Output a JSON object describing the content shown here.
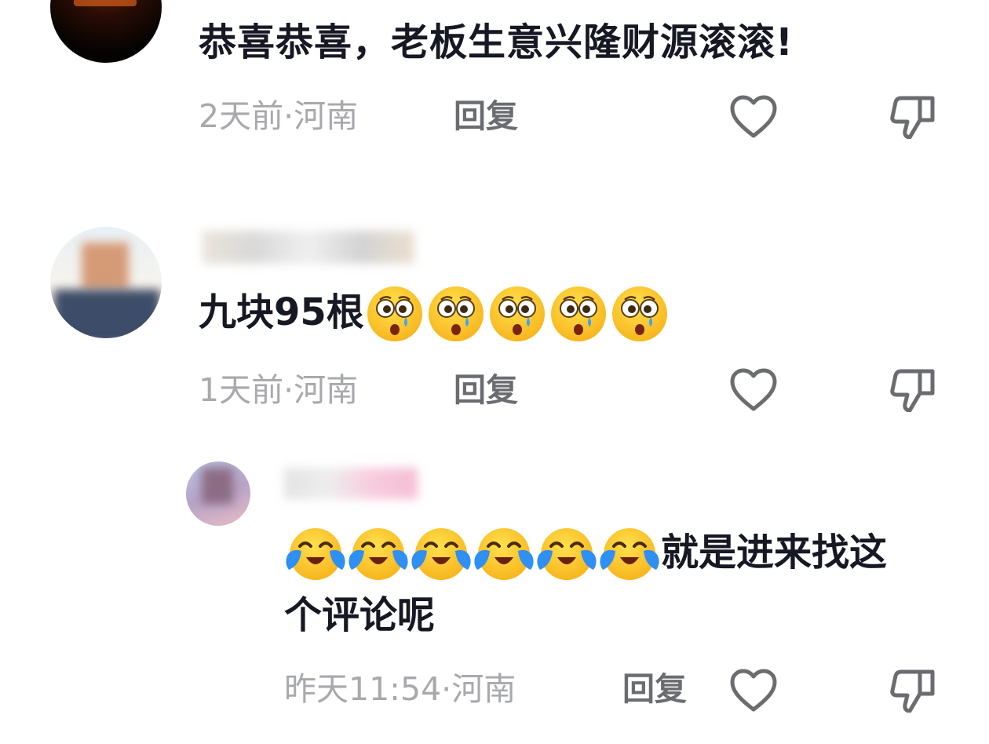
{
  "comments": [
    {
      "text": "恭喜恭喜，老板生意兴隆财源滚滚!",
      "time_location": "2天前·河南",
      "reply_label": "回复",
      "avatar_icon": "dark-fire-avatar"
    },
    {
      "text_prefix": "九块95根",
      "emoji_name": "crying-surprised-emoji",
      "emoji_count": 5,
      "time_location": "1天前·河南",
      "reply_label": "回复",
      "avatar_icon": "man-avatar-blurred"
    }
  ],
  "reply": {
    "emoji_name": "tears-of-joy-emoji",
    "emoji_count": 6,
    "text_line1": "就是进来找这",
    "text_line2": "个评论呢",
    "time_location": "昨天11:54·河南",
    "reply_label": "回复",
    "avatar_icon": "girl-avatar-blurred"
  },
  "icons": {
    "like": "heart-outline-icon",
    "dislike": "thumbs-down-outline-icon"
  },
  "colors": {
    "text": "#161823",
    "meta": "#a8a9ad",
    "reply": "#6b6c70",
    "icon": "#6b6c70"
  }
}
